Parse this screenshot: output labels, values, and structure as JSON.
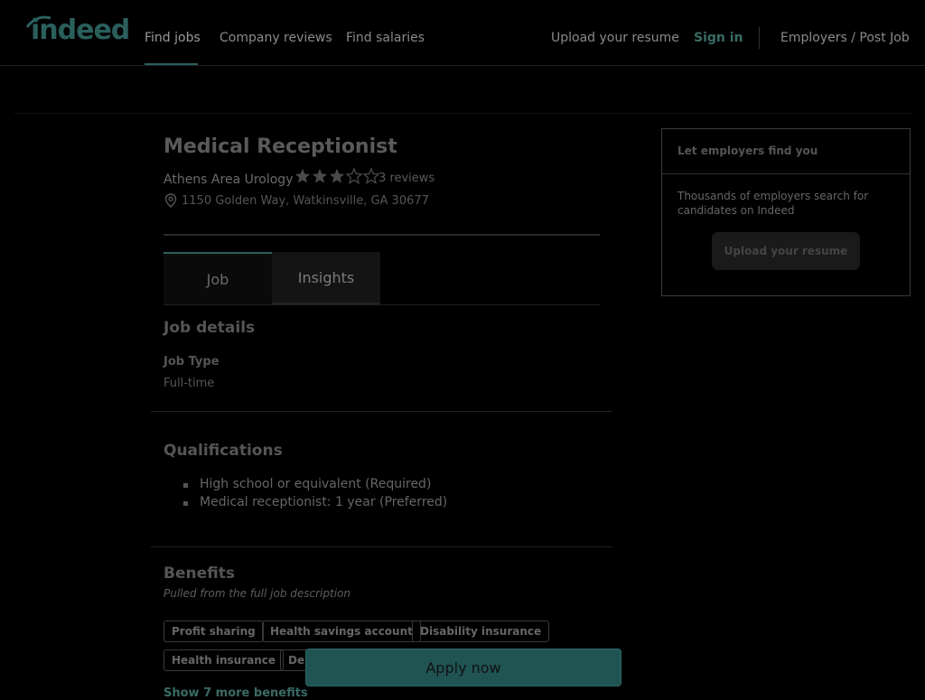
{
  "brand": {
    "logo_text": "indeed",
    "accent_color": "#2a5f5c"
  },
  "header": {
    "nav": [
      "Find jobs",
      "Company reviews",
      "Find salaries"
    ],
    "upload_resume": "Upload your resume",
    "sign_in": "Sign in",
    "employers": "Employers / Post Job"
  },
  "job": {
    "title": "Medical Receptionist",
    "company": "Athens Area Urology",
    "rating": 3,
    "rating_max": 5,
    "reviews": "3 reviews",
    "location": "1150 Golden Way, Watkinsville, GA 30677"
  },
  "tabs": [
    "Job",
    "Insights"
  ],
  "details": {
    "heading": "Job details",
    "job_type_label": "Job Type",
    "job_type_value": "Full-time"
  },
  "qualifications": {
    "heading": "Qualifications",
    "items": [
      "High school or equivalent (Required)",
      "Medical receptionist: 1 year (Preferred)"
    ]
  },
  "benefits": {
    "heading": "Benefits",
    "subtitle": "Pulled from the full job description",
    "chips": [
      "Profit sharing",
      "Health savings account",
      "Disability insurance",
      "Health insurance",
      "Dental insurance"
    ],
    "show_more": "Show 7 more benefits"
  },
  "apply_button": "Apply now",
  "sidebar": {
    "title": "Let employers find you",
    "body": "Thousands of employers search for candidates on Indeed",
    "button": "Upload your resume"
  }
}
